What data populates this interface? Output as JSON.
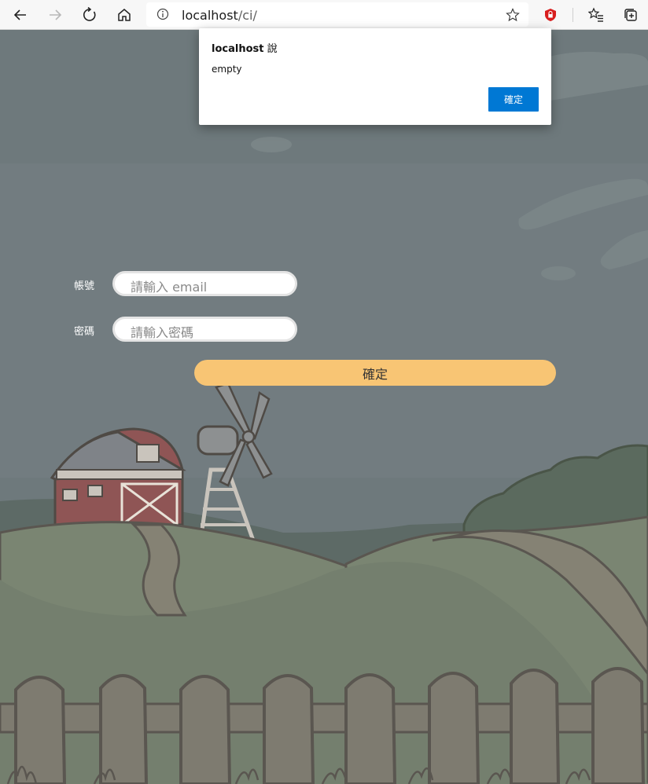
{
  "browser": {
    "url_host": "localhost",
    "url_path": "/ci/",
    "icons": [
      "back-icon",
      "forward-icon",
      "refresh-icon",
      "home-icon",
      "info-icon",
      "star-icon",
      "shield-extension-icon",
      "favorites-icon",
      "collections-icon"
    ]
  },
  "form": {
    "account_label": "帳號",
    "account_placeholder": "請輸入 email",
    "password_label": "密碼",
    "password_placeholder": "請輸入密碼",
    "submit_label": "確定"
  },
  "dialog": {
    "title_host": "localhost",
    "title_suffix": " 說",
    "message": "empty",
    "ok_label": "確定"
  },
  "colors": {
    "sky": "#6f7a7d",
    "button": "#f8c574",
    "dialog_ok": "#0078d4"
  }
}
